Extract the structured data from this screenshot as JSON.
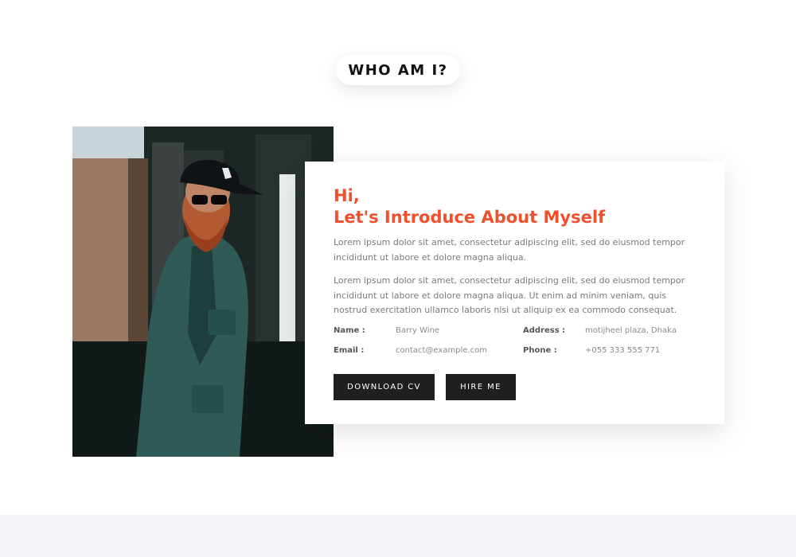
{
  "section": {
    "title": "WHO AM I?"
  },
  "about": {
    "greeting_line1": "Hi,",
    "greeting_line2": "Let's Introduce About Myself",
    "paragraph1": "Lorem ipsum dolor sit amet, consectetur adipiscing elit, sed do eiusmod tempor incididunt ut labore et dolore magna aliqua.",
    "paragraph2": "Lorem ipsum dolor sit amet, consectetur adipiscing elit, sed do eiusmod tempor incididunt ut labore et dolore magna aliqua. Ut enim ad minim veniam, quis nostrud exercitation ullamco laboris nisi ut aliquip ex ea commodo consequat.",
    "info": {
      "name_label": "Name :",
      "name_value": "Barry Wine",
      "address_label": "Address :",
      "address_value": "motijheel plaza, Dhaka",
      "email_label": "Email :",
      "email_value": "contact@example.com",
      "phone_label": "Phone :",
      "phone_value": "+055 333 555 771"
    },
    "buttons": {
      "download_cv": "DOWNLOAD CV",
      "hire_me": "HIRE ME"
    }
  },
  "colors": {
    "accent": "#f0502c",
    "button_bg": "#1f1f1f",
    "footer_band": "#f4f5f9"
  }
}
